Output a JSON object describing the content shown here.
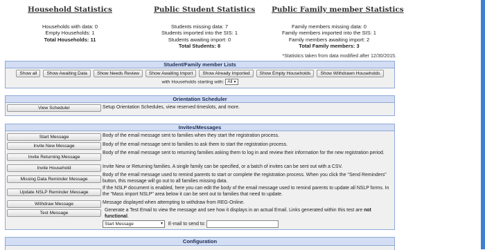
{
  "household_stats": {
    "title": "Household Statistics",
    "line1": "Households with data: 0",
    "line2": "Empty Households: 1",
    "total": "Total Households: 11"
  },
  "student_stats": {
    "title": "Public Student Statistics",
    "line1": "Students missing data: 7",
    "line2": "Students imported into the SIS: 1",
    "line3": "Students awaiting import: 0",
    "total": "Total Students: 8"
  },
  "family_stats": {
    "title": "Public Family member Statistics",
    "line1": "Family members missing data: 0",
    "line2": "Family members imported into the SIS: 1",
    "line3": "Family members awaiting import: 2",
    "total": "Total Family members: 3"
  },
  "stats_note": "*Statistics taken from data modified after 12/30/2015.",
  "lists": {
    "header": "Student/Family member Lists",
    "buttons": [
      "Show all",
      "Show Awaiting Data",
      "Show Needs Review",
      "Show Awaiting Import",
      "Show Already Imported",
      "Show Empty Households",
      "Show Withdrawn Households"
    ],
    "starting_label": "with Households starting with:",
    "starting_value": "All"
  },
  "orientation": {
    "header": "Orientation Scheduler",
    "button": "View Scheduler",
    "desc": "Setup Orientation Schedules, view reserved timeslots, and more."
  },
  "invites": {
    "header": "Invites/Messages",
    "rows": [
      {
        "button": "Start Message",
        "desc": "Body of the email message sent to families when they start the registration process."
      },
      {
        "button": "Invite New Message",
        "desc": "Body of the email message sent to families to ask them to start the registration process."
      },
      {
        "button": "Invite Returning Message",
        "desc": "Body of the email message sent to returning families asking them to log in and review their information for the new registration period."
      },
      {
        "button": "Invite Household",
        "desc": "Invite New or Returning families. A single family can be specified, or a batch of invites can be sent out with a CSV."
      },
      {
        "button": "Missing Data Reminder Message",
        "desc": "Body of the email message used to remind parents to start or complete the registration process. When you click the \"Send Reminders\" button, this message will go out to all families missing data."
      },
      {
        "button": "Update NSLP Reminder Message",
        "desc": "If the NSLP document is enabled, here you can edit the body of the email message used to remind parents to update all NSLP forms. In the \"Mass import NSLP\" area below it can be sent out to families that need to update."
      },
      {
        "button": "Withdraw Message",
        "desc": "Message displayed when attempting to withdraw from REG-Online."
      }
    ],
    "test_button": "Test Message",
    "test_desc": "Generate a Test Email to view the message and see how it displays in an actual Email. Links generated within this test are",
    "test_desc_bold": "not functional",
    "test_desc_end": ".",
    "test_select": "Start Message",
    "email_label": "E-mail to send to:"
  },
  "configuration": {
    "header": "Configuration"
  }
}
